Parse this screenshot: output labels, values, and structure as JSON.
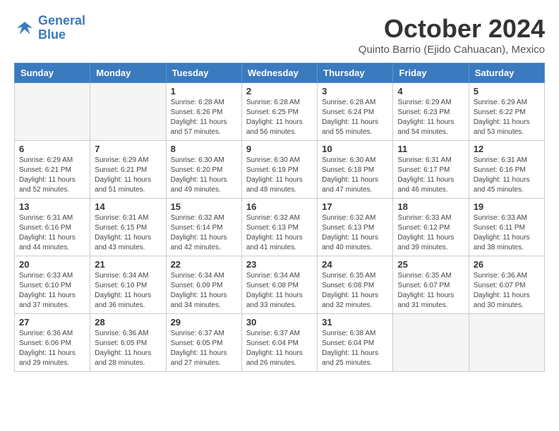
{
  "logo": {
    "line1": "General",
    "line2": "Blue"
  },
  "title": "October 2024",
  "subtitle": "Quinto Barrio (Ejido Cahuacan), Mexico",
  "days_header": [
    "Sunday",
    "Monday",
    "Tuesday",
    "Wednesday",
    "Thursday",
    "Friday",
    "Saturday"
  ],
  "weeks": [
    [
      {
        "num": "",
        "info": ""
      },
      {
        "num": "",
        "info": ""
      },
      {
        "num": "1",
        "info": "Sunrise: 6:28 AM\nSunset: 6:26 PM\nDaylight: 11 hours and 57 minutes."
      },
      {
        "num": "2",
        "info": "Sunrise: 6:28 AM\nSunset: 6:25 PM\nDaylight: 11 hours and 56 minutes."
      },
      {
        "num": "3",
        "info": "Sunrise: 6:28 AM\nSunset: 6:24 PM\nDaylight: 11 hours and 55 minutes."
      },
      {
        "num": "4",
        "info": "Sunrise: 6:29 AM\nSunset: 6:23 PM\nDaylight: 11 hours and 54 minutes."
      },
      {
        "num": "5",
        "info": "Sunrise: 6:29 AM\nSunset: 6:22 PM\nDaylight: 11 hours and 53 minutes."
      }
    ],
    [
      {
        "num": "6",
        "info": "Sunrise: 6:29 AM\nSunset: 6:21 PM\nDaylight: 11 hours and 52 minutes."
      },
      {
        "num": "7",
        "info": "Sunrise: 6:29 AM\nSunset: 6:21 PM\nDaylight: 11 hours and 51 minutes."
      },
      {
        "num": "8",
        "info": "Sunrise: 6:30 AM\nSunset: 6:20 PM\nDaylight: 11 hours and 49 minutes."
      },
      {
        "num": "9",
        "info": "Sunrise: 6:30 AM\nSunset: 6:19 PM\nDaylight: 11 hours and 48 minutes."
      },
      {
        "num": "10",
        "info": "Sunrise: 6:30 AM\nSunset: 6:18 PM\nDaylight: 11 hours and 47 minutes."
      },
      {
        "num": "11",
        "info": "Sunrise: 6:31 AM\nSunset: 6:17 PM\nDaylight: 11 hours and 46 minutes."
      },
      {
        "num": "12",
        "info": "Sunrise: 6:31 AM\nSunset: 6:16 PM\nDaylight: 11 hours and 45 minutes."
      }
    ],
    [
      {
        "num": "13",
        "info": "Sunrise: 6:31 AM\nSunset: 6:16 PM\nDaylight: 11 hours and 44 minutes."
      },
      {
        "num": "14",
        "info": "Sunrise: 6:31 AM\nSunset: 6:15 PM\nDaylight: 11 hours and 43 minutes."
      },
      {
        "num": "15",
        "info": "Sunrise: 6:32 AM\nSunset: 6:14 PM\nDaylight: 11 hours and 42 minutes."
      },
      {
        "num": "16",
        "info": "Sunrise: 6:32 AM\nSunset: 6:13 PM\nDaylight: 11 hours and 41 minutes."
      },
      {
        "num": "17",
        "info": "Sunrise: 6:32 AM\nSunset: 6:13 PM\nDaylight: 11 hours and 40 minutes."
      },
      {
        "num": "18",
        "info": "Sunrise: 6:33 AM\nSunset: 6:12 PM\nDaylight: 11 hours and 39 minutes."
      },
      {
        "num": "19",
        "info": "Sunrise: 6:33 AM\nSunset: 6:11 PM\nDaylight: 11 hours and 38 minutes."
      }
    ],
    [
      {
        "num": "20",
        "info": "Sunrise: 6:33 AM\nSunset: 6:10 PM\nDaylight: 11 hours and 37 minutes."
      },
      {
        "num": "21",
        "info": "Sunrise: 6:34 AM\nSunset: 6:10 PM\nDaylight: 11 hours and 36 minutes."
      },
      {
        "num": "22",
        "info": "Sunrise: 6:34 AM\nSunset: 6:09 PM\nDaylight: 11 hours and 34 minutes."
      },
      {
        "num": "23",
        "info": "Sunrise: 6:34 AM\nSunset: 6:08 PM\nDaylight: 11 hours and 33 minutes."
      },
      {
        "num": "24",
        "info": "Sunrise: 6:35 AM\nSunset: 6:08 PM\nDaylight: 11 hours and 32 minutes."
      },
      {
        "num": "25",
        "info": "Sunrise: 6:35 AM\nSunset: 6:07 PM\nDaylight: 11 hours and 31 minutes."
      },
      {
        "num": "26",
        "info": "Sunrise: 6:36 AM\nSunset: 6:07 PM\nDaylight: 11 hours and 30 minutes."
      }
    ],
    [
      {
        "num": "27",
        "info": "Sunrise: 6:36 AM\nSunset: 6:06 PM\nDaylight: 11 hours and 29 minutes."
      },
      {
        "num": "28",
        "info": "Sunrise: 6:36 AM\nSunset: 6:05 PM\nDaylight: 11 hours and 28 minutes."
      },
      {
        "num": "29",
        "info": "Sunrise: 6:37 AM\nSunset: 6:05 PM\nDaylight: 11 hours and 27 minutes."
      },
      {
        "num": "30",
        "info": "Sunrise: 6:37 AM\nSunset: 6:04 PM\nDaylight: 11 hours and 26 minutes."
      },
      {
        "num": "31",
        "info": "Sunrise: 6:38 AM\nSunset: 6:04 PM\nDaylight: 11 hours and 25 minutes."
      },
      {
        "num": "",
        "info": ""
      },
      {
        "num": "",
        "info": ""
      }
    ]
  ]
}
